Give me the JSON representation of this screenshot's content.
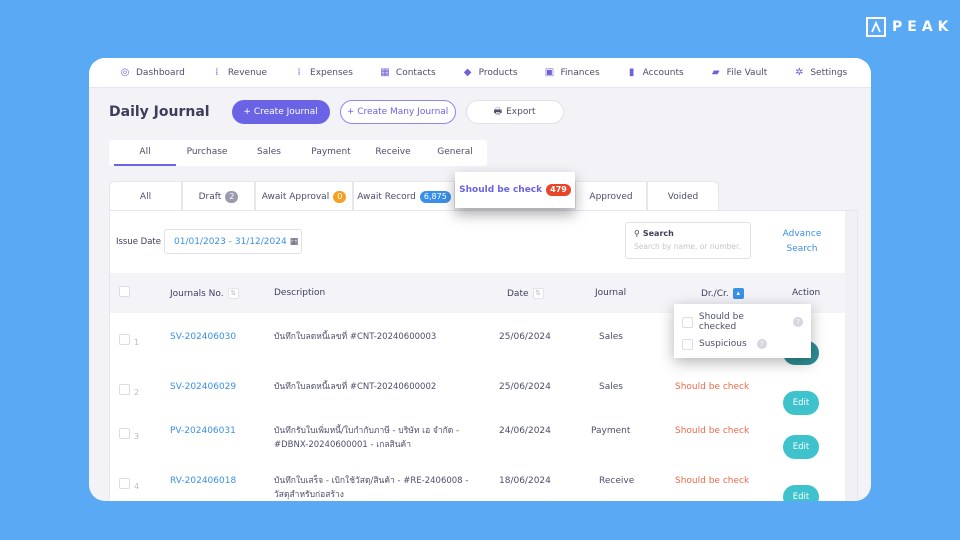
{
  "brand": {
    "name": "PEAK",
    "icon": "peak-logo-icon"
  },
  "nav": [
    {
      "label": "Dashboard",
      "icon": "dashboard-icon",
      "glyph": "◎"
    },
    {
      "label": "Revenue",
      "icon": "revenue-icon",
      "glyph": "⁞"
    },
    {
      "label": "Expenses",
      "icon": "expenses-icon",
      "glyph": "⁞"
    },
    {
      "label": "Contacts",
      "icon": "contacts-icon",
      "glyph": "▦"
    },
    {
      "label": "Products",
      "icon": "products-icon",
      "glyph": "◆"
    },
    {
      "label": "Finances",
      "icon": "finances-icon",
      "glyph": "▣"
    },
    {
      "label": "Accounts",
      "icon": "accounts-icon",
      "glyph": "▮"
    },
    {
      "label": "File Vault",
      "icon": "folder-icon",
      "glyph": "▰"
    },
    {
      "label": "Settings",
      "icon": "gear-icon",
      "glyph": "✲"
    }
  ],
  "header": {
    "title": "Daily Journal",
    "create_journal": "+ Create Journal",
    "create_many": "+ Create Many Journal",
    "export": "Export",
    "export_icon": "🖶"
  },
  "type_tabs": [
    {
      "label": "All",
      "active": true
    },
    {
      "label": "Purchase"
    },
    {
      "label": "Sales"
    },
    {
      "label": "Payment"
    },
    {
      "label": "Receive"
    },
    {
      "label": "General"
    }
  ],
  "status_tabs": [
    {
      "label": "All"
    },
    {
      "label": "Draft",
      "badge": "2",
      "badge_color": "#9b9bb0"
    },
    {
      "label": "Await Approval",
      "badge": "0",
      "badge_color": "#f5a020"
    },
    {
      "label": "Await Record",
      "badge": "6,875",
      "badge_color": "#3a8fe8"
    },
    {
      "label": "Should be check",
      "badge": "479",
      "badge_color": "#e9452a",
      "active": true
    },
    {
      "label": "Approved"
    },
    {
      "label": "Voided"
    }
  ],
  "filters": {
    "issue_date_label": "Issue Date",
    "issue_date_value": "01/01/2023 - 31/12/2024",
    "search_label": "Search",
    "search_placeholder": "Search by name, or number.",
    "advance_search": "Advance Search"
  },
  "table": {
    "columns": [
      "Journals No.",
      "Description",
      "Date",
      "Journal",
      "Dr./Cr.",
      "Action"
    ],
    "rows": [
      {
        "num": "1",
        "journal_no": "SV-202406030",
        "description": "บันทึกใบลดหนี้เลขที่ #CNT-20240600003",
        "date": "25/06/2024",
        "journal": "Sales",
        "drcr": "",
        "action": "Edit"
      },
      {
        "num": "2",
        "journal_no": "SV-202406029",
        "description": "บันทึกใบลดหนี้เลขที่ #CNT-20240600002",
        "date": "25/06/2024",
        "journal": "Sales",
        "drcr": "Should be check",
        "action": "Edit"
      },
      {
        "num": "3",
        "journal_no": "PV-202406031",
        "description": "บันทึกรับใบเพิ่มหนี้/ใบกำกับภาษี - บริษัท เอ จำกัด - #DBNX-20240600001 - เกลสินค้า",
        "date": "24/06/2024",
        "journal": "Payment",
        "drcr": "Should be check",
        "action": "Edit"
      },
      {
        "num": "4",
        "journal_no": "RV-202406018",
        "description": "บันทึกใบเสร็จ - เบิกใช้วัสดุ/สินค้า - #RE-2406008 - วัสดุสำหรับก่อสร้าง",
        "date": "18/06/2024",
        "journal": "Receive",
        "drcr": "Should be check",
        "action": "Edit"
      }
    ]
  },
  "drcr_filter": {
    "options": [
      {
        "label": "Should be checked",
        "checked": false
      },
      {
        "label": "Suspicious",
        "checked": false
      }
    ]
  }
}
